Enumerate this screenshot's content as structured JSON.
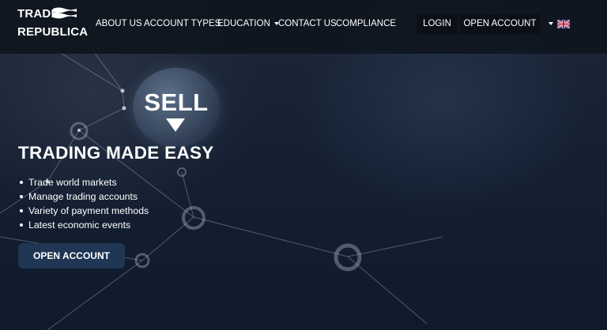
{
  "brand": {
    "logo_line1": "TRADE",
    "logo_line2": "REPUBLICA"
  },
  "nav": {
    "items": [
      {
        "label": "ABOUT US"
      },
      {
        "label": "ACCOUNT TYPES"
      },
      {
        "label": "EDUCATION",
        "has_dropdown": true
      },
      {
        "label": "CONTACT US"
      },
      {
        "label": "COMPLIANCE"
      }
    ],
    "login_label": "LOGIN",
    "open_account_label": "OPEN ACCOUNT",
    "language_icon": "uk-flag-icon"
  },
  "hero": {
    "bubble_text": "SELL",
    "headline": "TRADING MADE EASY",
    "features": [
      "Trade world markets",
      "Manage trading accounts",
      "Variety of payment methods",
      "Latest economic events"
    ],
    "cta_label": "OPEN ACCOUNT"
  },
  "colors": {
    "navbar_bg": "#0e141c",
    "hero_bg": "#152133",
    "cta_bg": "#1f3654",
    "text": "#ffffff"
  }
}
